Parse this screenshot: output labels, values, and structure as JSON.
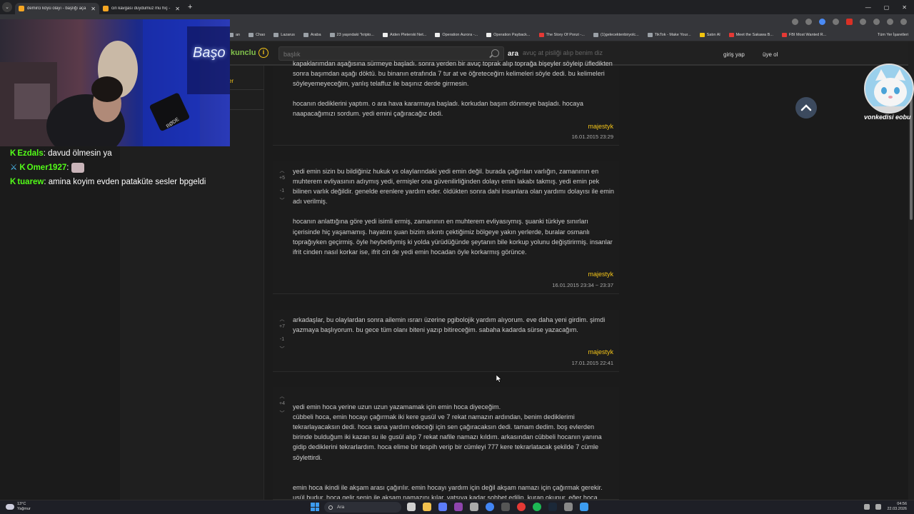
{
  "browser": {
    "tabs": [
      {
        "title": "demirci köyü olayı - başlığı aça",
        "active": true
      },
      {
        "title": "cin kavgası duydumuz mu hiç -",
        "active": false
      }
    ],
    "bookmarks": [
      {
        "label": "an",
        "color": "gray"
      },
      {
        "label": "Chao",
        "color": "gray"
      },
      {
        "label": "Lazarus",
        "color": "gray"
      },
      {
        "label": "Araba",
        "color": "gray"
      },
      {
        "label": "23 yaşındaki \"kripto...",
        "color": "gray"
      },
      {
        "label": "Aiden Pleterski Net...",
        "color": "white"
      },
      {
        "label": "Operation Aurora -...",
        "color": "white"
      },
      {
        "label": "Operation Payback...",
        "color": "white"
      },
      {
        "label": "The Story Of Ponzi -...",
        "color": "red"
      },
      {
        "label": "(1)gelecektenbiryolc...",
        "color": "gray"
      },
      {
        "label": "TikTok - Make Your...",
        "color": "gray"
      },
      {
        "label": "Satın Al",
        "color": "yellow"
      },
      {
        "label": "Meet the Sakawa B...",
        "color": "red"
      },
      {
        "label": "FBI Most Wanted R...",
        "color": "red"
      }
    ],
    "all_bookmarks_label": "Tüm Yer İşaretleri"
  },
  "site": {
    "logo": "kunclu",
    "search_placeholder": "başlık",
    "search_button": "ara",
    "header_teaser": "avuç at pisliği alıp benim diz",
    "login": "giriş yap",
    "register": "üye ol",
    "side_stub": "er"
  },
  "entries": [
    {
      "paragraphs": [
        "kapaklarımdan aşağısına sürmeye başladı. sonra yerden bir avuç toprak alıp toprağa bişeyler söyleip üfledikten sonra başımdan aşağı döktü. bu binanın etrafında 7 tur at ve öğreteceğim kelimeleri söyle dedi. bu kelimeleri söyleyemeyeceğim, yanlış telaffuz ile başınız derde girmesin.",
        "hocanın dediklerini yaptım. o ara hava kararmaya başladı. korkudan başım dönmeye başladı. hocaya naapacağımızı sordum. yedi emini çağıracağız dedi."
      ],
      "author": "majestyk",
      "date": "16.01.2015 23:29"
    },
    {
      "up": "+5",
      "down": "-1",
      "paragraphs": [
        "yedi emin sizin bu bildiğiniz hukuk vs olaylarındaki yedi emin değil. burada çağırılan varlığın, zamanının en muhterem evliyasının adıymış yedi, ermişler ona güvenilirliğinden dolayı emin lakabı takmış. yedi emin pek bilinen varlık değildir. genelde erenlere yardım eder. öldükten sonra dahi insanlara olan yardımı dolayısı ile emin adı verilmiş.",
        "hocanın anlattığına göre yedi isimli ermiş, zamanının en muhterem evliyasıymış. şuanki türkiye sınırları içerisinde hiç yaşamamış. hayatını şuan bizim sıkıntı çektiğimiz bölgeye yakın yerlerde, buralar osmanlı toprağıyken geçirmiş. öyle heybetliymiş ki yolda yürüdüğünde şeytanın bile korkup yolunu değiştirirmiş. insanlar ifrit cinden nasıl korkar ise, ifrit cin de yedi emin hocadan öyle korkarmış görünce."
      ],
      "author": "majestyk",
      "date": "16.01.2015 23:34 ~ 23:37"
    },
    {
      "up": "+7",
      "down": "-1",
      "paragraphs": [
        "arkadaşlar, bu olaylardan sonra ailemin ısrarı üzerine pgibolojik yardım alıyorum. eve daha yeni girdim. şimdi yazmaya başlıyorum. bu gece tüm olanı biteni yazıp bitireceğim. sabaha kadarda sürse yazacağım."
      ],
      "author": "majestyk",
      "date": "17.01.2015 22:41"
    },
    {
      "up": "+4",
      "paragraphs": [
        "yedi emin hoca yerine uzun uzun yazamamak için emin hoca diyeceğim.\ncübbeli hoca, emin hocayı çağırmak iki kere gusül ve 7 rekat namazın ardından, benim dediklerimi tekrarlayacaksın dedi. hoca sana yardım edeceği için sen çağıracaksın dedi. tamam dedim. boş evlerden birinde bulduğum iki kazan su ile gusül alıp 7 rekat nafile namazı kıldım. arkasından cübbeli hocanın yanına gidip dediklerini tekrarlardım. hoca elime bir tespih verip bir cümleyi 777 kere tekrarlatacak şekilde 7 cümle söylettirdi.",
        "emin hoca ikindi ile akşam arası çağırılır. emin hocayı yardım için değil akşam namazı için çağırmak gerekir. usül budur. hoca gelir senin ile akşam namazını kılar. yatsıya kadar sohbet edilip, kuran okunur. eğer hoca haline acır ise yanında kalır yardım eder, aksi halde yatsıyı kıldıktan sonra gider."
      ]
    }
  ],
  "overlay": {
    "chat": [
      {
        "user": "Ezdals",
        "text": "davud ölmesin ya",
        "badge": "K",
        "emote": false
      },
      {
        "user": "Omer1927",
        "text": "",
        "badge": "K",
        "emote": true
      },
      {
        "user": "tuarew",
        "text": "amina koyim evden pataküte sesler bpgeldi",
        "badge": "K",
        "emote": false
      }
    ],
    "webcam_sign": "Başo",
    "mic_brand": "RØDE",
    "cat_caption": "vonkedisi eobu"
  },
  "taskbar": {
    "weather_temp": "13°C",
    "weather_desc": "Yağmur",
    "search_label": "Ara",
    "time": "04:56",
    "date": "22.03.2026"
  },
  "colors": {
    "accent_yellow": "#f5c518",
    "logo_green": "#81c14b",
    "chat_green": "#53fc18",
    "background": "#1b1b1b"
  }
}
